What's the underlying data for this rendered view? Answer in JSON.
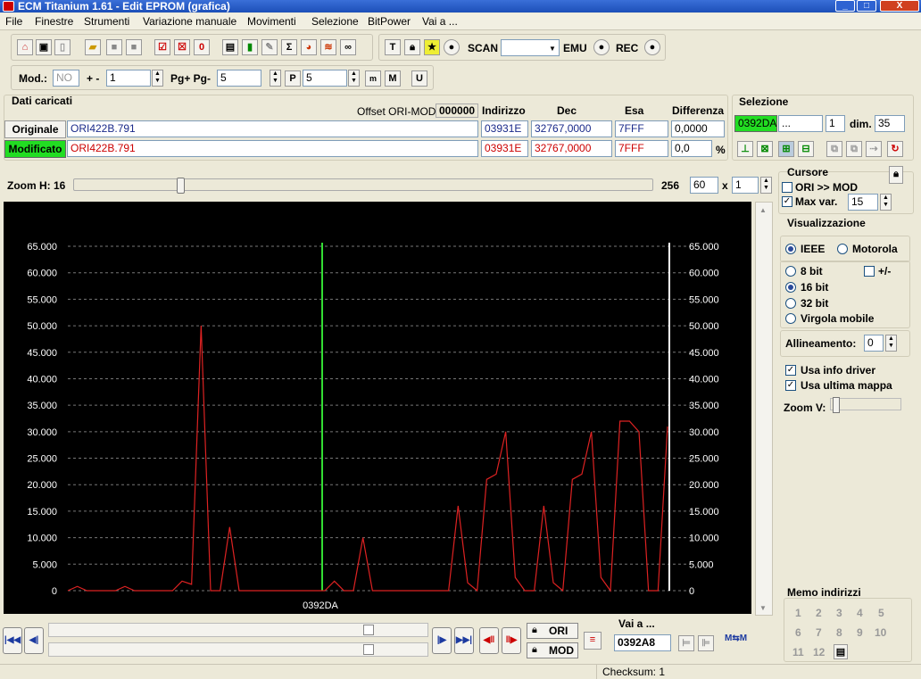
{
  "window": {
    "title": "ECM Titanium 1.61 - Edit EPROM (grafica)"
  },
  "menu": [
    "File",
    "Finestre",
    "Strumenti",
    "Variazione manuale",
    "Movimenti",
    "Selezione",
    "BitPower",
    "Vai a ..."
  ],
  "toolbar1": {
    "scan_label": "SCAN",
    "emu_label": "EMU",
    "rec_label": "REC",
    "scan_value": ""
  },
  "toolbar2": {
    "mod_label": "Mod.:",
    "mod_value": "NO",
    "plusminus_label": "+ -",
    "step_value": "1",
    "pg_label": "Pg+ Pg-",
    "pg_value": "5",
    "p_value": "5"
  },
  "dati": {
    "title": "Dati caricati",
    "offset_label": "Offset ORI-MOD",
    "offset_value": "000000",
    "col_indirizzo": "Indirizzo",
    "col_dec": "Dec",
    "col_esa": "Esa",
    "col_diff": "Differenza",
    "originale": {
      "label": "Originale",
      "file": "ORI422B.791",
      "indirizzo": "03931E",
      "dec": "32767,0000",
      "esa": "7FFF",
      "diff": "0,0000"
    },
    "modificato": {
      "label": "Modificato",
      "file": "ORI422B.791",
      "indirizzo": "03931E",
      "dec": "32767,0000",
      "esa": "7FFF",
      "diff": "0,0",
      "diff_unit": "%"
    }
  },
  "selezione": {
    "title": "Selezione",
    "address": "0392DA",
    "end": "...",
    "count": "1",
    "dim_label": "dim.",
    "dim_value": "35"
  },
  "zoom": {
    "label": "Zoom H: 16",
    "value_256": "256",
    "w": "60",
    "x_label": "x",
    "h": "1",
    "slider_fraction": 0.18
  },
  "cursore": {
    "title": "Cursore",
    "ori_mod": "ORI >> MOD",
    "maxvar_label": "Max var.",
    "maxvar_value": "15"
  },
  "visualizzazione": {
    "title": "Visualizzazione",
    "ieee": "IEEE",
    "motorola": "Motorola",
    "bit8": "8 bit",
    "plusminus": "+/-",
    "bit16": "16 bit",
    "bit32": "32 bit",
    "virgola": "Virgola mobile",
    "allineamento_label": "Allineamento:",
    "allineamento_value": "0",
    "usa_info": "Usa info driver",
    "usa_ultima": "Usa ultima mappa",
    "zoomv_label": "Zoom V:"
  },
  "memo": {
    "title": "Memo indirizzi",
    "items": [
      "1",
      "2",
      "3",
      "4",
      "5",
      "6",
      "7",
      "8",
      "9",
      "10",
      "11",
      "12"
    ]
  },
  "bottom": {
    "ori_label": "ORI",
    "mod_label": "MOD",
    "vaia_label": "Vai a ...",
    "vaia_value": "0392A8"
  },
  "status": {
    "checksum": "Checksum: 1"
  },
  "chart_data": {
    "type": "line",
    "ylim": [
      0,
      65000
    ],
    "yticks": [
      "65.000",
      "60.000",
      "55.000",
      "50.000",
      "45.000",
      "40.000",
      "35.000",
      "30.000",
      "25.000",
      "20.000",
      "15.000",
      "10.000",
      "5.000",
      "0"
    ],
    "xlabel": "0392DA",
    "cursor_color": "#33dd33",
    "series_color": "#dd2222",
    "values": [
      0,
      800,
      0,
      0,
      0,
      0,
      800,
      0,
      0,
      0,
      0,
      0,
      1800,
      1200,
      50000,
      0,
      0,
      12000,
      0,
      0,
      0,
      0,
      0,
      0,
      0,
      0,
      0,
      0,
      1800,
      0,
      0,
      10000,
      0,
      0,
      0,
      0,
      0,
      0,
      0,
      0,
      0,
      16000,
      1500,
      0,
      21000,
      22000,
      30000,
      2500,
      0,
      0,
      16000,
      1500,
      0,
      21000,
      22000,
      30000,
      2500,
      0,
      32000,
      32000,
      30000,
      0,
      0,
      31000
    ]
  }
}
